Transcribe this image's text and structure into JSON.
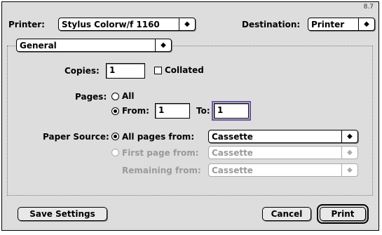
{
  "header": {
    "version": "8.7",
    "printer_label": "Printer:",
    "printer_value": "Stylus Colorw/f 1160",
    "destination_label": "Destination:",
    "destination_value": "Printer"
  },
  "panel": {
    "value": "General"
  },
  "copies": {
    "label": "Copies:",
    "value": "1",
    "collated_label": "Collated",
    "collated_checked": false
  },
  "pages": {
    "label": "Pages:",
    "all_label": "All",
    "from_label": "From:",
    "from_value": "1",
    "to_label": "To:",
    "to_value": "1",
    "selected": "from"
  },
  "paper_source": {
    "label": "Paper Source:",
    "all_pages_label": "All pages from:",
    "all_pages_value": "Cassette",
    "first_page_label": "First page from:",
    "first_page_value": "Cassette",
    "remaining_label": "Remaining from:",
    "remaining_value": "Cassette"
  },
  "buttons": {
    "save_settings": "Save Settings",
    "cancel": "Cancel",
    "print": "Print"
  },
  "icons": {
    "popup_arrows": "up-down-arrows-icon"
  }
}
